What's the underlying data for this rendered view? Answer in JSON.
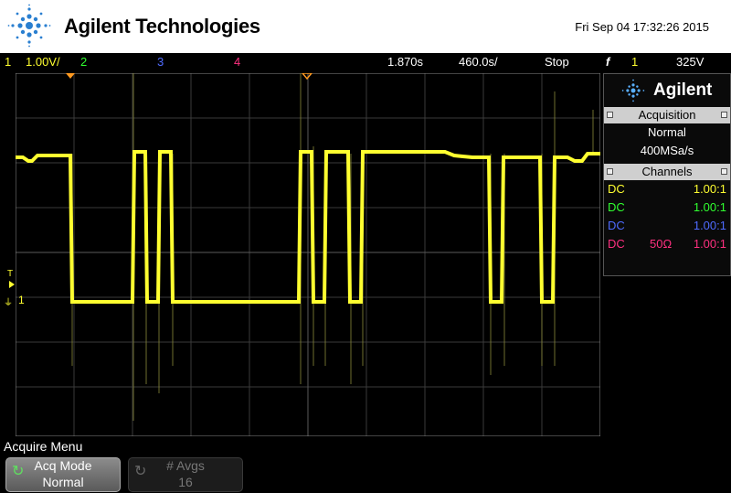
{
  "header": {
    "brand": "Agilent Technologies",
    "datetime": "Fri Sep 04 17:32:26 2015"
  },
  "status": {
    "ch1_num": "1",
    "ch1_scale": "1.00V/",
    "ch2_num": "2",
    "ch3_num": "3",
    "ch4_num": "4",
    "delay": "1.870s",
    "timebase": "460.0s/",
    "run_state": "Stop",
    "trigger_symbol": "f",
    "trigger_ch": "1",
    "trigger_level": "325V",
    "colors": {
      "ch1": "#ffff30",
      "ch2": "#30ff30",
      "ch3": "#4f6bff",
      "ch4": "#ff3080"
    }
  },
  "plot": {
    "trigger_marker_label": "T",
    "ch1_ground_label": "1"
  },
  "panel": {
    "logo_text": "Agilent",
    "acq_title": "Acquisition",
    "acq_mode": "Normal",
    "acq_rate": "400MSa/s",
    "channels_title": "Channels",
    "rows": [
      {
        "coupling": "DC",
        "impedance": "",
        "probe": "1.00:1",
        "color": "#ffff30"
      },
      {
        "coupling": "DC",
        "impedance": "",
        "probe": "1.00:1",
        "color": "#30ff30"
      },
      {
        "coupling": "DC",
        "impedance": "",
        "probe": "1.00:1",
        "color": "#4f6bff"
      },
      {
        "coupling": "DC",
        "impedance": "50Ω",
        "probe": "1.00:1",
        "color": "#ff3080"
      }
    ]
  },
  "softkeys": {
    "menu_title": "Acquire Menu",
    "acq_mode_label": "Acq Mode",
    "acq_mode_value": "Normal",
    "avgs_label": "# Avgs",
    "avgs_value": "16"
  }
}
